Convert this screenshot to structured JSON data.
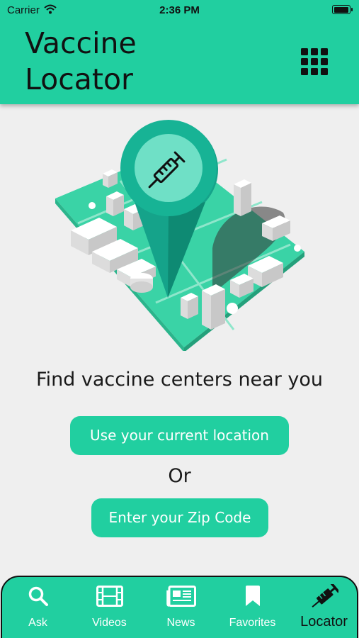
{
  "status": {
    "carrier": "Carrier",
    "time": "2:36 PM",
    "battery_level": 1.0
  },
  "header": {
    "title_line1": "Vaccine",
    "title_line2": "Locator",
    "menu_icon": "grid-icon"
  },
  "main": {
    "headline": "Find vaccine centers near you",
    "location_button": "Use your current location",
    "or_text": "Or",
    "zip_button": "Enter your Zip Code"
  },
  "tabs": [
    {
      "label": "Ask",
      "icon": "search-icon",
      "active": false
    },
    {
      "label": "Videos",
      "icon": "film-icon",
      "active": false
    },
    {
      "label": "News",
      "icon": "newspaper-icon",
      "active": false
    },
    {
      "label": "Favorites",
      "icon": "bookmark-icon",
      "active": false
    },
    {
      "label": "Locator",
      "icon": "syringe-icon",
      "active": true
    }
  ],
  "colors": {
    "accent": "#21cfa0",
    "background": "#efefef",
    "text": "#1a1a1a"
  }
}
